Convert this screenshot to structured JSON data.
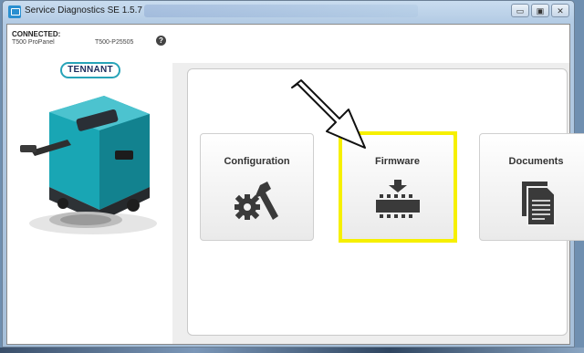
{
  "window": {
    "title": "Service Diagnostics SE 1.5.7",
    "controls": {
      "minimize": "▭",
      "maximize": "▣",
      "close": "✕"
    }
  },
  "connection": {
    "status": "CONNECTED:",
    "model": "T500 ProPanel",
    "serial": "T500-P25505"
  },
  "logo": {
    "text": "TENNANT"
  },
  "tiles": [
    {
      "label": "Configuration",
      "icon": "gear-wrench-icon"
    },
    {
      "label": "Firmware",
      "icon": "chip-download-icon"
    },
    {
      "label": "Documents",
      "icon": "documents-icon"
    }
  ],
  "colors": {
    "highlight": "#f6f000",
    "icon_dark": "#3a3a3a",
    "brand_teal": "#27a3b8",
    "brand_navy": "#1b2b5c"
  }
}
